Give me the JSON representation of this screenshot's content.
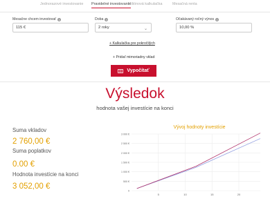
{
  "tabs": [
    {
      "label": "Jednorazové investovanie",
      "active": false
    },
    {
      "label": "Pravidelné investovanie",
      "active": true
    },
    {
      "label": "Miliónová kalkulačka",
      "active": false
    },
    {
      "label": "Mesačná renta",
      "active": false
    }
  ],
  "form": {
    "monthly_amount": {
      "label": "Mesačne chcem investovať",
      "value": "115 €"
    },
    "duration": {
      "label": "Doba",
      "value": "2 roky"
    },
    "expected_return": {
      "label": "Očakávaný ročný výnos",
      "value": "10,00 %"
    }
  },
  "links": {
    "advanced": "+ Kalkulačka pre pokročilých",
    "extra_deposit": "+ Pridať mimoriadny vklad"
  },
  "calculate_button": {
    "label": "Vypočítať",
    "icon": "calculator-icon"
  },
  "result": {
    "title": "Výsledok",
    "subtitle": "hodnota vašej investície na konci",
    "deposits_label": "Suma vkladov",
    "deposits_value": "2 760,00 €",
    "fees_label": "Suma poplatkov",
    "fees_value": "0.00 €",
    "final_label": "Hodnota investície na konci",
    "final_value": "3 052,00 €"
  },
  "colors": {
    "accent": "#c8102e",
    "highlight": "#e3a000",
    "series_value": "#b0306a",
    "series_deposits": "#8e9be0"
  },
  "chart_data": {
    "type": "line",
    "title": "Vývoj hodnoty investície",
    "xlabel": "",
    "ylabel": "",
    "xlim": [
      0,
      24
    ],
    "ylim": [
      0,
      3000
    ],
    "x_ticks": [
      5,
      10,
      15,
      20
    ],
    "y_ticks": [
      0,
      500,
      1000,
      1500,
      2000,
      2500,
      3000
    ],
    "y_tick_labels": [
      "0",
      "500 €",
      "1 000 €",
      "1 500 €",
      "2 000 €",
      "2 500 €",
      "3 000 €"
    ],
    "grid": true,
    "series": [
      {
        "values": [
          115,
          1235,
          2760
        ],
        "x": [
          1,
          12,
          24
        ]
      },
      {
        "values": [
          115,
          1290,
          3052
        ],
        "x": [
          1,
          12,
          24
        ]
      }
    ]
  }
}
